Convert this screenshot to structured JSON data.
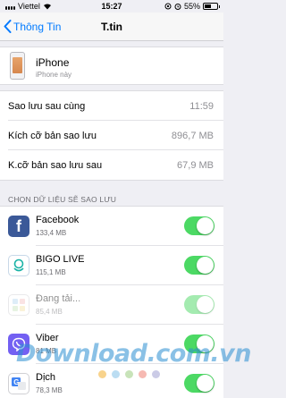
{
  "status_bar": {
    "carrier": "Viettel",
    "time": "15:27",
    "battery": "55%"
  },
  "nav": {
    "back_label": "Thông Tin",
    "title": "T.tin"
  },
  "device": {
    "name": "iPhone",
    "subtitle": "iPhone này"
  },
  "info_rows": [
    {
      "label": "Sao lưu sau cùng",
      "value": "11:59"
    },
    {
      "label": "Kích cỡ bản sao lưu",
      "value": "896,7 MB"
    },
    {
      "label": "K.cỡ bản sao lưu sau",
      "value": "67,9 MB"
    }
  ],
  "section_header": "CHỌN DỮ LIỆU SẼ SAO LƯU",
  "apps": [
    {
      "name": "Facebook",
      "size": "133,4 MB",
      "enabled": true,
      "icon": "facebook-icon"
    },
    {
      "name": "BIGO LIVE",
      "size": "115,1 MB",
      "enabled": true,
      "icon": "bigo-live-icon"
    },
    {
      "name": "Đang tải...",
      "size": "85,4 MB",
      "enabled": true,
      "icon": "loading-app-icon"
    },
    {
      "name": "Viber",
      "size": "81 MB",
      "enabled": true,
      "icon": "viber-icon"
    },
    {
      "name": "Dịch",
      "size": "78,3 MB",
      "enabled": true,
      "icon": "translate-icon"
    }
  ],
  "watermark": {
    "text": "Download.com.vn",
    "dot_colors": [
      "#f4b63f",
      "#8ec6ea",
      "#a3d18a",
      "#f08a7e",
      "#a9a9d6"
    ]
  },
  "colors": {
    "accent": "#007aff",
    "toggle_on": "#4cd964",
    "facebook": "#3b5998",
    "viber": "#7360f2"
  }
}
